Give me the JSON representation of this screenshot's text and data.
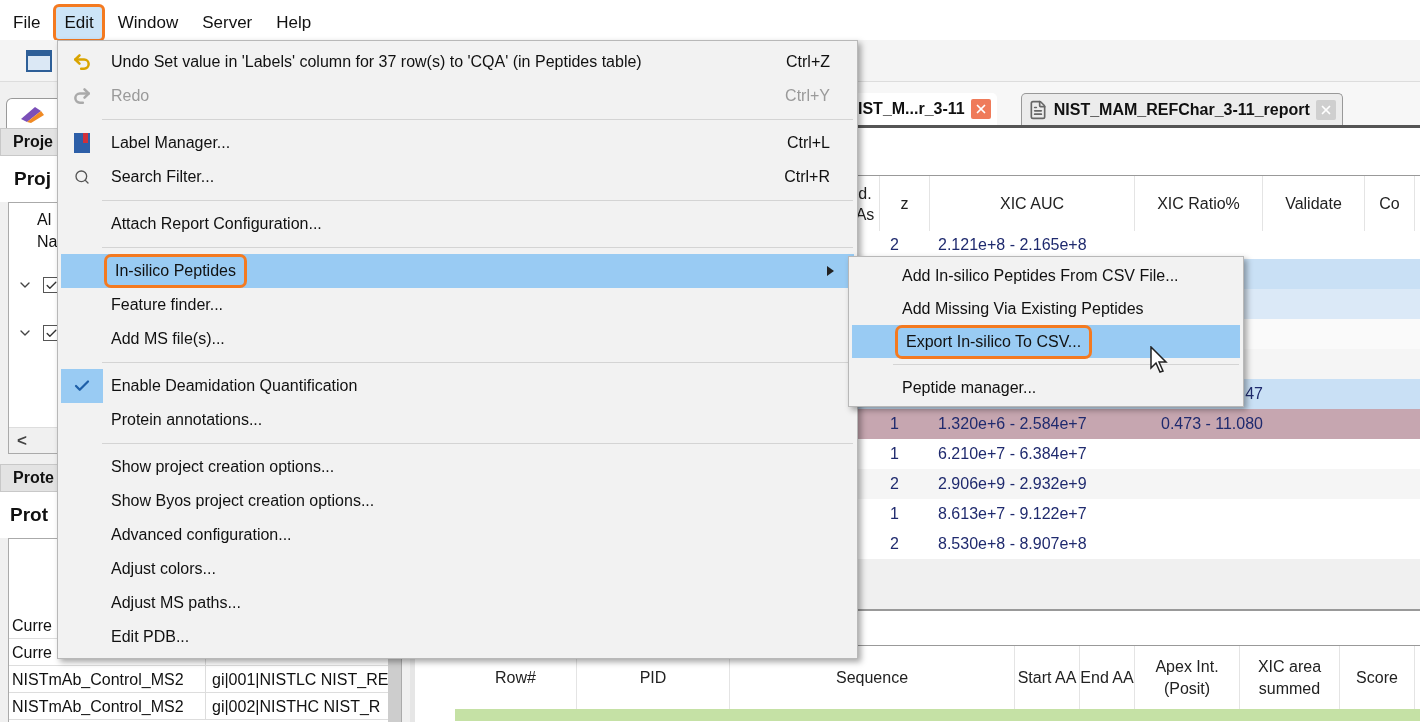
{
  "menubar": [
    {
      "label": "File",
      "selected": false
    },
    {
      "label": "Edit",
      "selected": true,
      "callout": true
    },
    {
      "label": "Window",
      "selected": false
    },
    {
      "label": "Server",
      "selected": false
    },
    {
      "label": "Help",
      "selected": false
    }
  ],
  "edit_menu": {
    "items": [
      {
        "kind": "item",
        "label": "Undo Set value in 'Labels' column for 37 row(s) to 'CQA' (in Peptides table)",
        "shortcut": "Ctrl+Z",
        "disabled": false,
        "selected": false
      },
      {
        "kind": "item",
        "label": "Redo",
        "shortcut": "Ctrl+Y",
        "disabled": true,
        "selected": false
      },
      {
        "kind": "separator"
      },
      {
        "kind": "item",
        "label": "Label Manager...",
        "shortcut": "Ctrl+L",
        "disabled": false,
        "selected": false
      },
      {
        "kind": "item",
        "label": "Search Filter...",
        "shortcut": "Ctrl+R",
        "disabled": false,
        "selected": false
      },
      {
        "kind": "separator"
      },
      {
        "kind": "item",
        "label": "Attach Report Configuration...",
        "disabled": false,
        "selected": false
      },
      {
        "kind": "separator"
      },
      {
        "kind": "submenu",
        "label": "In-silico Peptides",
        "disabled": false,
        "selected": true,
        "callout": true
      },
      {
        "kind": "item",
        "label": "Feature finder...",
        "disabled": false,
        "selected": false
      },
      {
        "kind": "item",
        "label": "Add MS file(s)...",
        "disabled": false,
        "selected": false
      },
      {
        "kind": "separator"
      },
      {
        "kind": "check",
        "label": "Enable Deamidation Quantification",
        "checked": true,
        "disabled": false,
        "selected": false
      },
      {
        "kind": "item",
        "label": "Protein annotations...",
        "disabled": false,
        "selected": false
      },
      {
        "kind": "separator"
      },
      {
        "kind": "item",
        "label": "Show project creation options...",
        "disabled": false,
        "selected": false
      },
      {
        "kind": "item",
        "label": "Show Byos project creation options...",
        "disabled": false,
        "selected": false
      },
      {
        "kind": "item",
        "label": "Advanced configuration...",
        "disabled": false,
        "selected": false
      },
      {
        "kind": "item",
        "label": "Adjust colors...",
        "disabled": false,
        "selected": false
      },
      {
        "kind": "item",
        "label": "Adjust MS paths...",
        "disabled": false,
        "selected": false
      },
      {
        "kind": "item",
        "label": "Edit PDB...",
        "disabled": false,
        "selected": false
      }
    ]
  },
  "submenu": {
    "items": [
      {
        "kind": "item",
        "label": "Add In-silico Peptides From CSV File...",
        "disabled": false,
        "selected": false
      },
      {
        "kind": "item",
        "label": "Add Missing Via Existing Peptides",
        "disabled": false,
        "selected": false
      },
      {
        "kind": "item",
        "label": "Export In-silico To CSV...",
        "disabled": false,
        "selected": true,
        "callout": true
      },
      {
        "kind": "separator"
      },
      {
        "kind": "item",
        "label": "Peptide manager...",
        "disabled": false,
        "selected": false
      }
    ]
  },
  "left_panel": {
    "project_header": "Proje",
    "project_title": "Proj",
    "tree_header": [
      "Al",
      "Na"
    ],
    "tree_rows": [
      {
        "expanded": true,
        "checked": true
      },
      {
        "expanded": true,
        "checked": true
      }
    ],
    "scroll_left": "<",
    "protein_header": "Prote",
    "protein_title": "Prot",
    "table_rows": [
      [
        "Curre"
      ],
      [
        "Curre"
      ],
      [
        "NISTmAb_Control_MS2",
        "gi|001|NISTLC NIST_RE"
      ],
      [
        "NISTmAb_Control_MS2",
        "gi|002|NISTHC NIST_R"
      ]
    ]
  },
  "doc_tabs": [
    {
      "label": "IST_M...r_3-11",
      "selected": true
    },
    {
      "label": "NIST_MAM_REFChar_3-11_report",
      "selected": false
    }
  ],
  "peptide_table": {
    "columns": [
      "d. As",
      "z",
      "XIC AUC",
      "XIC Ratio%",
      "Validate",
      "Co"
    ],
    "rows": [
      {
        "cells": [
          "",
          "2",
          "2.121e+8 - 2.165e+8",
          ""
        ],
        "color": "#ffffff"
      },
      {
        "cells": [],
        "color": "#c9e0f5"
      },
      {
        "cells": [],
        "color": "#dbe9f7"
      },
      {
        "cells": [],
        "color": "#fafafa"
      },
      {
        "cells": [],
        "color": "#f5f5f5"
      },
      {
        "cells": [
          "",
          "",
          "",
          "47"
        ],
        "color": "#c9e0f5"
      },
      {
        "cells": [
          "",
          "1",
          "1.320e+6 - 2.584e+7",
          "0.473 - 11.080"
        ],
        "color": "#c6a6b0"
      },
      {
        "cells": [
          "",
          "1",
          "6.210e+7 - 6.384e+7",
          ""
        ],
        "color": "#ffffff"
      },
      {
        "cells": [
          "",
          "2",
          "2.906e+9 - 2.932e+9",
          ""
        ],
        "color": "#f5f5f5"
      },
      {
        "cells": [
          "",
          "1",
          "8.613e+7 - 9.122e+7",
          ""
        ],
        "color": "#ffffff"
      },
      {
        "cells": [
          "",
          "2",
          "8.530e+8 - 8.907e+8",
          ""
        ],
        "color": "#ffffff"
      }
    ]
  },
  "result_table": {
    "columns": [
      "Row#",
      "PID",
      "Sequence",
      "Start AA",
      "End AA",
      "Apex Int. (Posit)",
      "XIC area summed",
      "Score"
    ],
    "rows": [
      {
        "color": "#c5e1a5"
      }
    ]
  }
}
